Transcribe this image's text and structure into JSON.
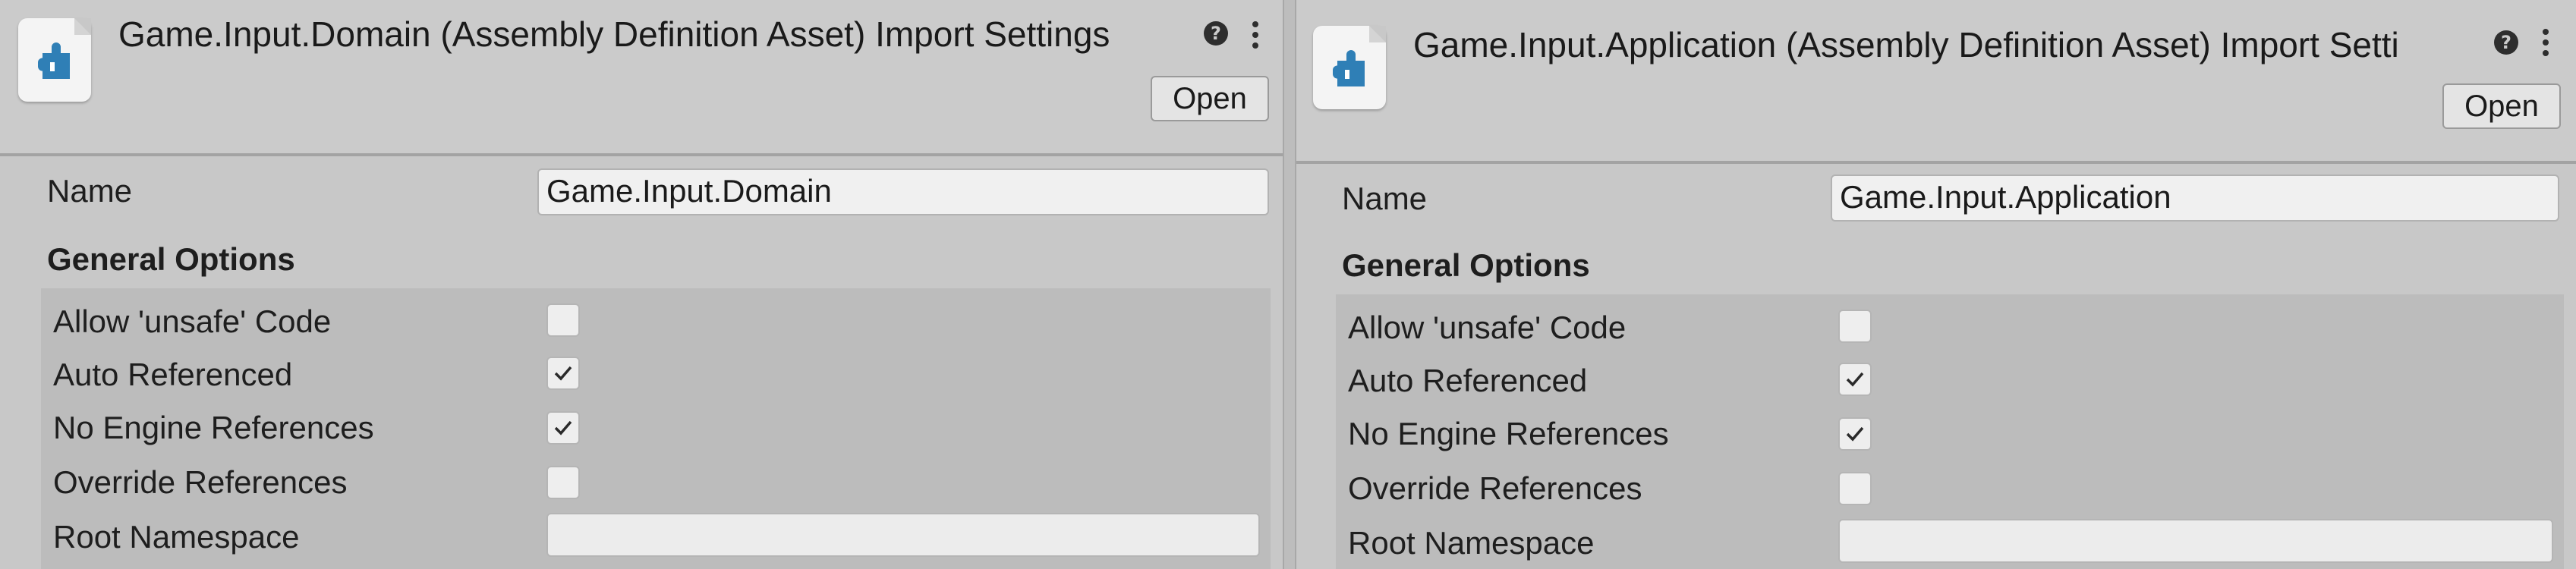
{
  "panels": [
    {
      "title": "Game.Input.Domain (Assembly Definition Asset) Import Settings",
      "help_icon": "help-icon",
      "menu_icon": "kebab-menu-icon",
      "open_label": "Open",
      "name_label": "Name",
      "name_value": "Game.Input.Domain",
      "section_title": "General Options",
      "options": [
        {
          "label": "Allow 'unsafe' Code",
          "checked": false
        },
        {
          "label": "Auto Referenced",
          "checked": true
        },
        {
          "label": "No Engine References",
          "checked": true
        },
        {
          "label": "Override References",
          "checked": false
        }
      ],
      "root_namespace_label": "Root Namespace",
      "root_namespace_value": ""
    },
    {
      "title": "Game.Input.Application (Assembly Definition Asset) Import Setti",
      "help_icon": "help-icon",
      "menu_icon": "kebab-menu-icon",
      "open_label": "Open",
      "name_label": "Name",
      "name_value": "Game.Input.Application",
      "section_title": "General Options",
      "options": [
        {
          "label": "Allow 'unsafe' Code",
          "checked": false
        },
        {
          "label": "Auto Referenced",
          "checked": true
        },
        {
          "label": "No Engine References",
          "checked": true
        },
        {
          "label": "Override References",
          "checked": false
        }
      ],
      "root_namespace_label": "Root Namespace",
      "root_namespace_value": ""
    }
  ],
  "colors": {
    "icon_blue": "#2f7fb6",
    "panel_bg": "#c8c8c8",
    "options_bg": "#bcbcbc"
  }
}
